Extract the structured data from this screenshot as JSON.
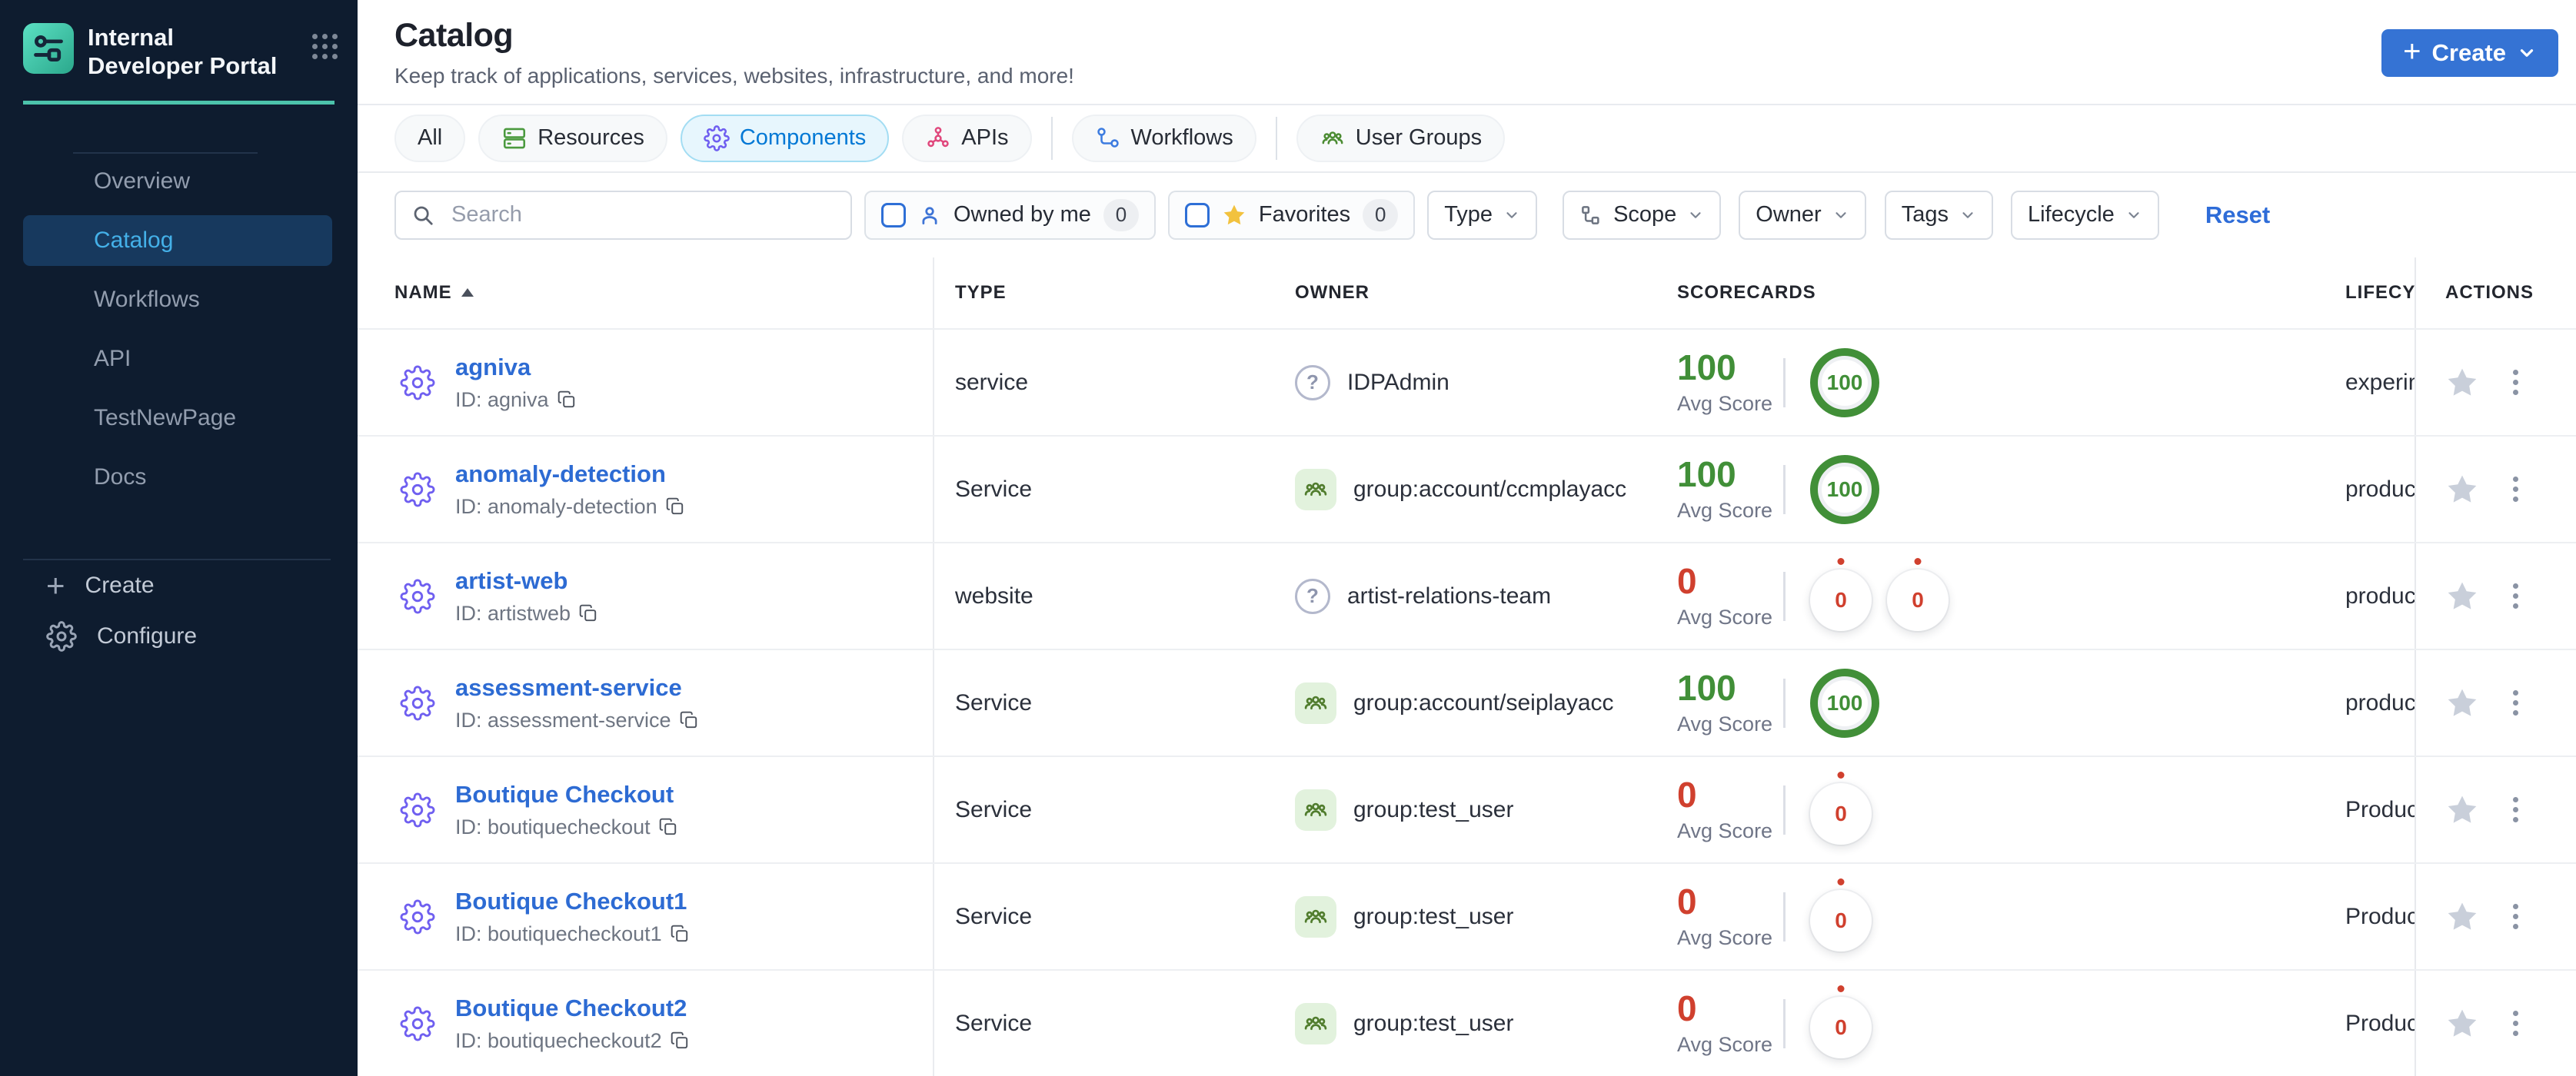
{
  "colors": {
    "sidebar_bg": "#0e1c2f",
    "teal_accent": "#4cc3ab",
    "primary_blue": "#3573d4",
    "link_blue": "#2d6bd3",
    "active_tab_blue": "#0278d5",
    "score_green": "#418f38",
    "score_red": "#d0402e",
    "component_purple": "#6f5ff0"
  },
  "sidebar": {
    "brand_title": "Internal Developer Portal",
    "nav": [
      {
        "label": "Overview",
        "active": false
      },
      {
        "label": "Catalog",
        "active": true
      },
      {
        "label": "Workflows",
        "active": false
      },
      {
        "label": "API",
        "active": false
      },
      {
        "label": "TestNewPage",
        "active": false
      },
      {
        "label": "Docs",
        "active": false
      }
    ],
    "create_label": "Create",
    "configure_label": "Configure"
  },
  "header": {
    "title": "Catalog",
    "subtitle": "Keep track of applications, services, websites, infrastructure, and more!",
    "create_button_label": "Create"
  },
  "tabs": [
    {
      "label": "All",
      "icon": null,
      "active": false
    },
    {
      "label": "Resources",
      "icon": "resources-icon",
      "active": false
    },
    {
      "label": "Components",
      "icon": "components-gear-icon",
      "active": true
    },
    {
      "label": "APIs",
      "icon": "api-hub-icon",
      "active": false
    },
    {
      "label": "Workflows",
      "icon": "workflow-icon",
      "active": false
    },
    {
      "label": "User Groups",
      "icon": "user-groups-icon",
      "active": false
    }
  ],
  "filters": {
    "search_placeholder": "Search",
    "owned_by_me": {
      "label": "Owned by me",
      "count": "0"
    },
    "favorites": {
      "label": "Favorites",
      "count": "0"
    },
    "dropdowns": [
      "Type",
      "Scope",
      "Owner",
      "Tags",
      "Lifecycle"
    ],
    "reset_label": "Reset"
  },
  "table": {
    "columns": {
      "name": "NAME",
      "type": "TYPE",
      "owner": "OWNER",
      "scorecards": "SCORECARDS",
      "lifecycle": "LIFECYCLE",
      "actions": "ACTIONS"
    },
    "avg_score_label": "Avg Score",
    "rows": [
      {
        "name": "agniva",
        "id": "ID: agniva",
        "type": "service",
        "owner": {
          "icon": "question",
          "label": "IDPAdmin"
        },
        "avg_score": "100",
        "score_state": "good",
        "badges": [
          {
            "value": "100",
            "state": "good"
          }
        ],
        "lifecycle": "experimental"
      },
      {
        "name": "anomaly-detection",
        "id": "ID: anomaly-detection",
        "type": "Service",
        "owner": {
          "icon": "group",
          "label": "group:account/ccmplayacc"
        },
        "avg_score": "100",
        "score_state": "good",
        "badges": [
          {
            "value": "100",
            "state": "good"
          }
        ],
        "lifecycle": "production"
      },
      {
        "name": "artist-web",
        "id": "ID: artistweb",
        "type": "website",
        "owner": {
          "icon": "question",
          "label": "artist-relations-team"
        },
        "avg_score": "0",
        "score_state": "bad",
        "badges": [
          {
            "value": "0",
            "state": "bad"
          },
          {
            "value": "0",
            "state": "bad"
          }
        ],
        "lifecycle": "production"
      },
      {
        "name": "assessment-service",
        "id": "ID: assessment-service",
        "type": "Service",
        "owner": {
          "icon": "group",
          "label": "group:account/seiplayacc"
        },
        "avg_score": "100",
        "score_state": "good",
        "badges": [
          {
            "value": "100",
            "state": "good"
          }
        ],
        "lifecycle": "production"
      },
      {
        "name": "Boutique Checkout",
        "id": "ID: boutiquecheckout",
        "type": "Service",
        "owner": {
          "icon": "group",
          "label": "group:test_user"
        },
        "avg_score": "0",
        "score_state": "bad",
        "badges": [
          {
            "value": "0",
            "state": "bad"
          }
        ],
        "lifecycle": "Production"
      },
      {
        "name": "Boutique Checkout1",
        "id": "ID: boutiquecheckout1",
        "type": "Service",
        "owner": {
          "icon": "group",
          "label": "group:test_user"
        },
        "avg_score": "0",
        "score_state": "bad",
        "badges": [
          {
            "value": "0",
            "state": "bad"
          }
        ],
        "lifecycle": "Production"
      },
      {
        "name": "Boutique Checkout2",
        "id": "ID: boutiquecheckout2",
        "type": "Service",
        "owner": {
          "icon": "group",
          "label": "group:test_user"
        },
        "avg_score": "0",
        "score_state": "bad",
        "badges": [
          {
            "value": "0",
            "state": "bad"
          }
        ],
        "lifecycle": "Production"
      }
    ]
  }
}
